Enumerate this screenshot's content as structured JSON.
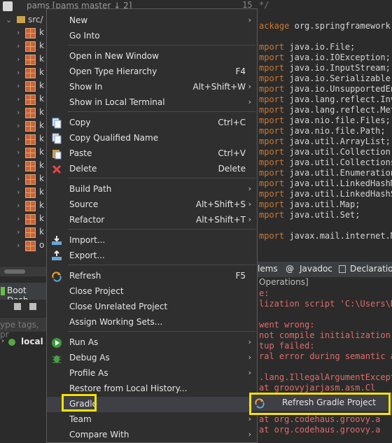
{
  "explorer": {
    "project_label": "pams [pams master ↓ 2]",
    "src_label": "src/",
    "package_rows": [
      "k",
      "k",
      "k",
      "k",
      "k",
      "k",
      "k",
      "k",
      "k",
      "k",
      "k",
      "k",
      "k",
      "k",
      "k",
      "k",
      "o"
    ]
  },
  "editor": {
    "line_number": "15",
    "line_15_text": "*/",
    "code_lines": [
      {
        "kw": "ackage",
        "txt": "org.springframework."
      },
      {
        "kw": "",
        "txt": ""
      },
      {
        "kw": "mport",
        "txt": "java.io.File;"
      },
      {
        "kw": "mport",
        "txt": "java.io.IOException;"
      },
      {
        "kw": "mport",
        "txt": "java.io.InputStream;"
      },
      {
        "kw": "mport",
        "txt": "java.io.Serializable;"
      },
      {
        "kw": "mport",
        "txt": "java.io.UnsupportedEn"
      },
      {
        "kw": "mport",
        "txt": "java.lang.reflect.Inv"
      },
      {
        "kw": "mport",
        "txt": "java.lang.reflect.Met"
      },
      {
        "kw": "mport",
        "txt": "java.nio.file.Files;"
      },
      {
        "kw": "mport",
        "txt": "java.nio.file.Path;"
      },
      {
        "kw": "mport",
        "txt": "java.util.ArrayList;"
      },
      {
        "kw": "mport",
        "txt": "java.util.Collection;"
      },
      {
        "kw": "mport",
        "txt": "java.util.Collections"
      },
      {
        "kw": "mport",
        "txt": "java.util.Enumeration"
      },
      {
        "kw": "mport",
        "txt": "java.util.LinkedHashM"
      },
      {
        "kw": "mport",
        "txt": "java.util.LinkedHashS"
      },
      {
        "kw": "mport",
        "txt": "java.util.Map;"
      },
      {
        "kw": "mport",
        "txt": "java.util.Set;"
      },
      {
        "kw": "",
        "txt": ""
      },
      {
        "kw": "mport",
        "txt": "javax.mail.internet.M"
      }
    ]
  },
  "console": {
    "tabs": [
      "lems",
      "Javadoc",
      "Declaration"
    ],
    "header": "Operations]",
    "lines": [
      "e:",
      "lization script 'C:\\Users\\D",
      "",
      " went wrong:",
      "not compile initialization",
      "tup failed:",
      "ral error during semantic a",
      "",
      ".lang.IllegalArgumentExcept",
      "  at groovyjarjasm.asm.Cl",
      "",
      "  at groovyjarjasm.asm.Cl",
      "  at org.codehaus.groovy.a",
      "  at org.codehaus.groovy.a"
    ]
  },
  "boot": {
    "tab_label": "Boot Dash",
    "filter_placeholder": "ype tags, pr",
    "local_label": "local"
  },
  "menu": {
    "items": [
      {
        "label": "New",
        "accel": "",
        "submenu": true
      },
      {
        "label": "Go Into",
        "accel": "",
        "submenu": false
      },
      {
        "label": "Open in New Window",
        "accel": "",
        "submenu": false
      },
      {
        "label": "Open Type Hierarchy",
        "accel": "F4",
        "submenu": false
      },
      {
        "label": "Show In",
        "accel": "Alt+Shift+W",
        "submenu": true
      },
      {
        "label": "Show in Local Terminal",
        "accel": "",
        "submenu": true
      },
      {
        "label": "Copy",
        "accel": "Ctrl+C",
        "submenu": false
      },
      {
        "label": "Copy Qualified Name",
        "accel": "",
        "submenu": false
      },
      {
        "label": "Paste",
        "accel": "Ctrl+V",
        "submenu": false
      },
      {
        "label": "Delete",
        "accel": "Delete",
        "submenu": false
      },
      {
        "label": "Build Path",
        "accel": "",
        "submenu": true
      },
      {
        "label": "Source",
        "accel": "Alt+Shift+S",
        "submenu": true
      },
      {
        "label": "Refactor",
        "accel": "Alt+Shift+T",
        "submenu": true
      },
      {
        "label": "Import...",
        "accel": "",
        "submenu": false
      },
      {
        "label": "Export...",
        "accel": "",
        "submenu": false
      },
      {
        "label": "Refresh",
        "accel": "F5",
        "submenu": false
      },
      {
        "label": "Close Project",
        "accel": "",
        "submenu": false
      },
      {
        "label": "Close Unrelated Project",
        "accel": "",
        "submenu": false
      },
      {
        "label": "Assign Working Sets...",
        "accel": "",
        "submenu": false
      },
      {
        "label": "Run As",
        "accel": "",
        "submenu": true
      },
      {
        "label": "Debug As",
        "accel": "",
        "submenu": true
      },
      {
        "label": "Profile As",
        "accel": "",
        "submenu": true
      },
      {
        "label": "Restore from Local History...",
        "accel": "",
        "submenu": false
      },
      {
        "label": "Gradle",
        "accel": "",
        "submenu": true
      },
      {
        "label": "Team",
        "accel": "",
        "submenu": true
      },
      {
        "label": "Compare With",
        "accel": "",
        "submenu": true
      }
    ]
  },
  "submenu": {
    "item_label": "Refresh Gradle Project"
  },
  "colors": {
    "highlight": "#f5e300",
    "keyword": "#cc7832",
    "error": "#e06c6c"
  }
}
